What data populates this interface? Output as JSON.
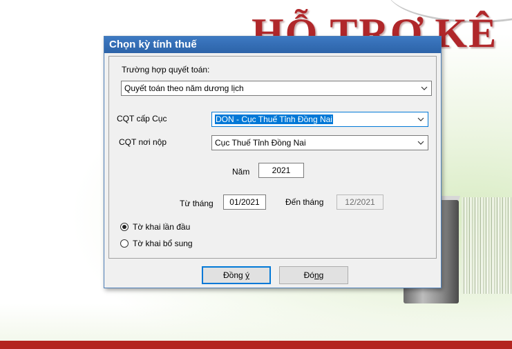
{
  "background": {
    "title_letters": [
      "H",
      "Ỗ",
      " ",
      "T",
      "R",
      "Ợ",
      " ",
      "K",
      "Ê"
    ],
    "accent_color": "#b0272a"
  },
  "dialog": {
    "title": "Chọn kỳ tính thuế",
    "case_label": "Trường hợp quyết toán:",
    "case_value": "Quyết toán theo năm dương lịch",
    "cqt_cuc_label": "CQT cấp Cục",
    "cqt_cuc_value": "DON - Cục Thuế Tỉnh Đồng Nai",
    "cqt_nop_label": "CQT nơi nộp",
    "cqt_nop_value": "Cục Thuế Tỉnh Đồng Nai",
    "year_label": "Năm",
    "year_value": "2021",
    "from_label": "Từ tháng",
    "from_value": "01/2021",
    "to_label": "Đến tháng",
    "to_value": "12/2021",
    "radio_first": "Tờ khai lần đầu",
    "radio_supplement": "Tờ khai bổ sung",
    "radio_selected": "first",
    "ok_prefix": "Đồng ",
    "ok_mnemonic": "ý",
    "close_prefix": "Đó",
    "close_mnemonic": "n",
    "close_suffix": "g"
  },
  "colors": {
    "titlebar": "#2c63a8",
    "selection": "#0078d7",
    "bottom_band": "#b3251f"
  },
  "icons": [
    "chevron-down-icon"
  ]
}
